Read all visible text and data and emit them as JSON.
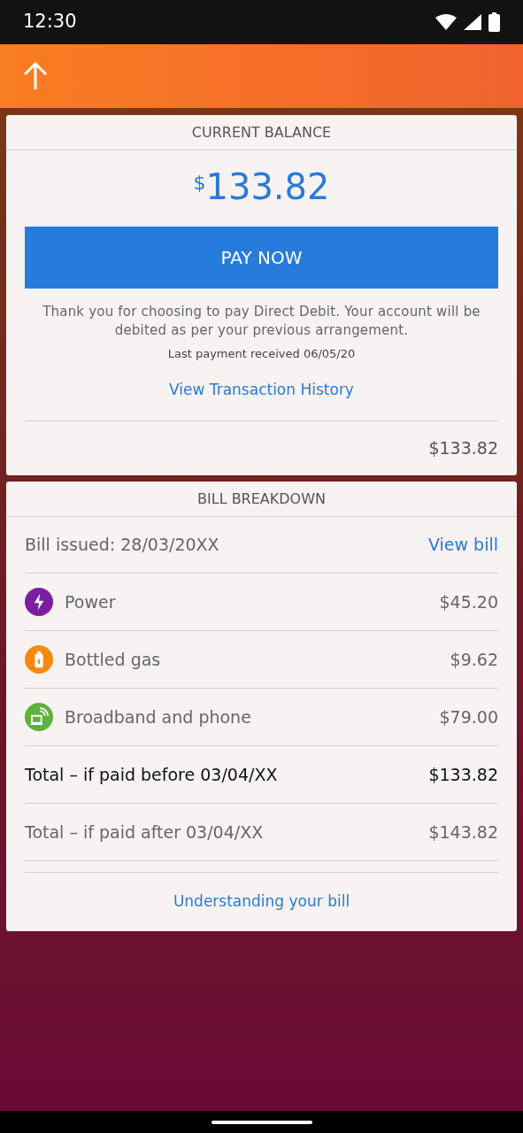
{
  "status_bar": {
    "time": "12:30"
  },
  "balance_card": {
    "title": "CURRENT BALANCE",
    "currency": "$",
    "amount": "133.82",
    "pay_button": "PAY NOW",
    "message": "Thank you for choosing to pay Direct Debit. Your account will be debited as per your previous arrangement.",
    "last_payment": "Last payment received 06/05/20",
    "history_link": "View Transaction History",
    "footer_amount": "$133.82"
  },
  "bill_card": {
    "title": "BILL BREAKDOWN",
    "issued": "Bill issued: 28/03/20XX",
    "view_bill": "View bill",
    "items": [
      {
        "label": "Power",
        "amount": "$45.20",
        "color": "#7b1fa2"
      },
      {
        "label": "Bottled gas",
        "amount": "$9.62",
        "color": "#f7890f"
      },
      {
        "label": "Broadband and phone",
        "amount": "$79.00",
        "color": "#5db339"
      }
    ],
    "totals": [
      {
        "label": "Total – if paid before 03/04/XX",
        "amount": "$133.82",
        "emphasized": true
      },
      {
        "label": "Total – if paid after 03/04/XX",
        "amount": "$143.82",
        "emphasized": false
      }
    ],
    "help_link": "Understanding your bill"
  }
}
